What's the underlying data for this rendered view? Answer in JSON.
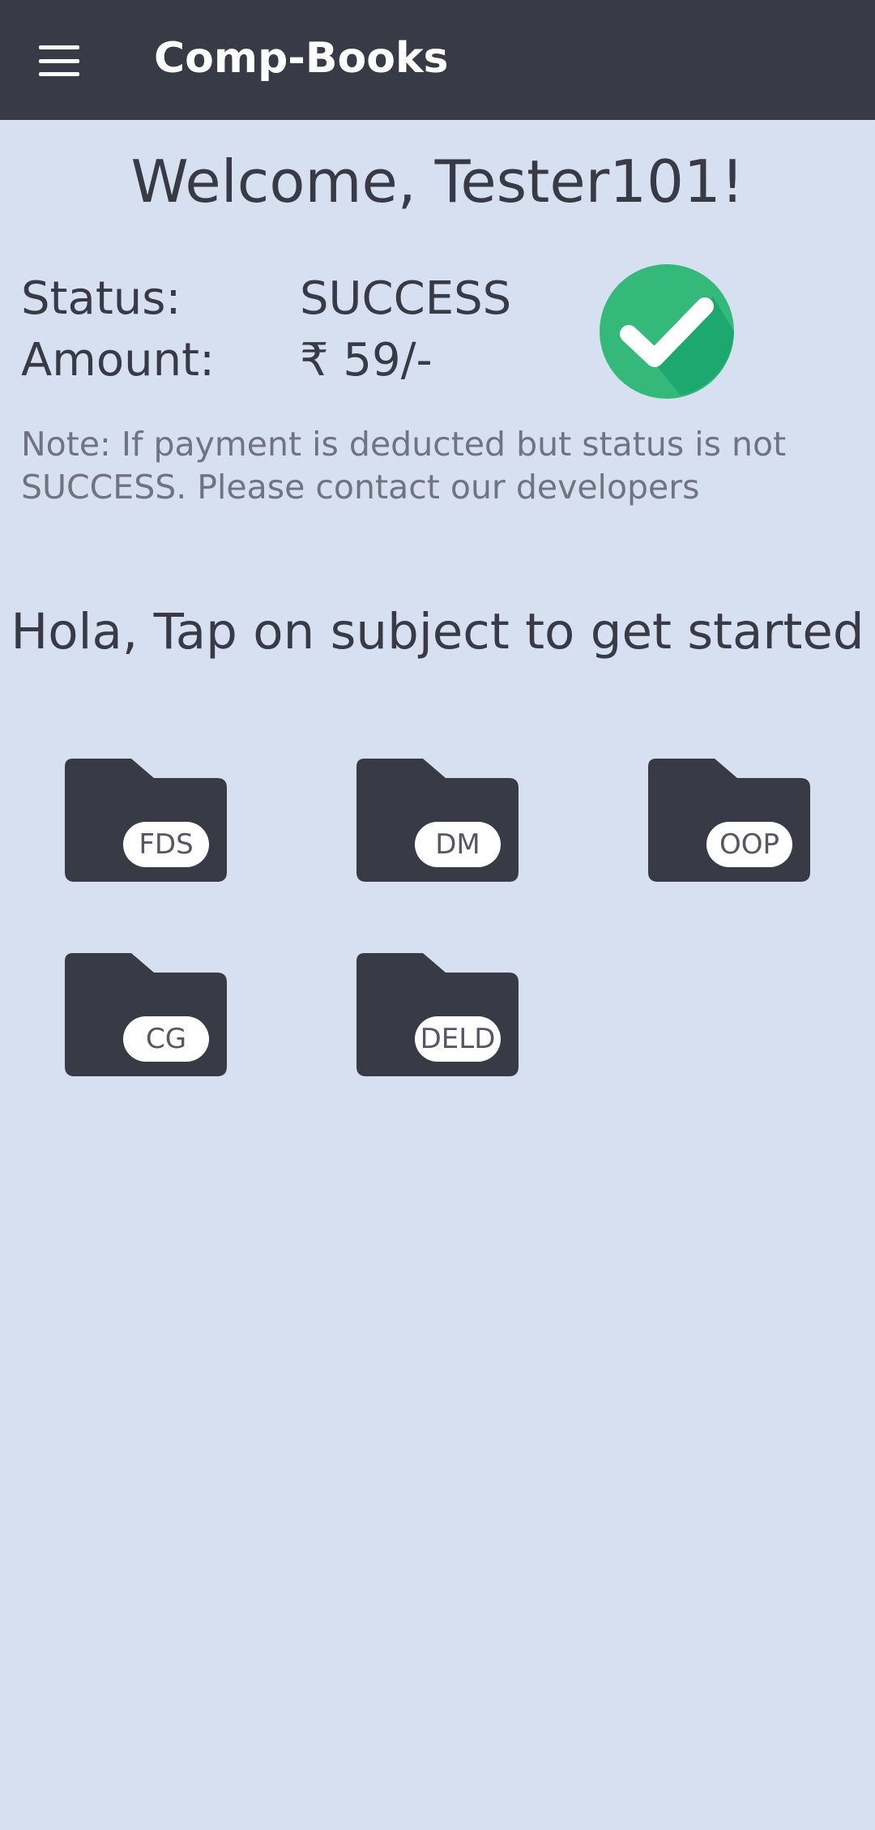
{
  "appbar": {
    "title": "Comp-Books",
    "menu_icon": "hamburger-menu-icon"
  },
  "welcome": "Welcome, Tester101!",
  "payment": {
    "status_label": "Status:",
    "status_value": "SUCCESS",
    "amount_label": "Amount:",
    "amount_value": "₹ 59/-",
    "status_icon": "check-circle-icon",
    "status_color": "#34b97b"
  },
  "note": "Note: If payment is deducted but status is not SUCCESS. Please contact our developers",
  "prompt": "Hola, Tap on subject to get started",
  "subjects": [
    {
      "label": "FDS",
      "icon": "folder-icon"
    },
    {
      "label": "DM",
      "icon": "folder-icon"
    },
    {
      "label": "OOP",
      "icon": "folder-icon"
    },
    {
      "label": "CG",
      "icon": "folder-icon"
    },
    {
      "label": "DELD",
      "icon": "folder-icon"
    }
  ],
  "colors": {
    "appbar": "#383a45",
    "background": "#d7e0f0",
    "folder": "#383a45"
  }
}
